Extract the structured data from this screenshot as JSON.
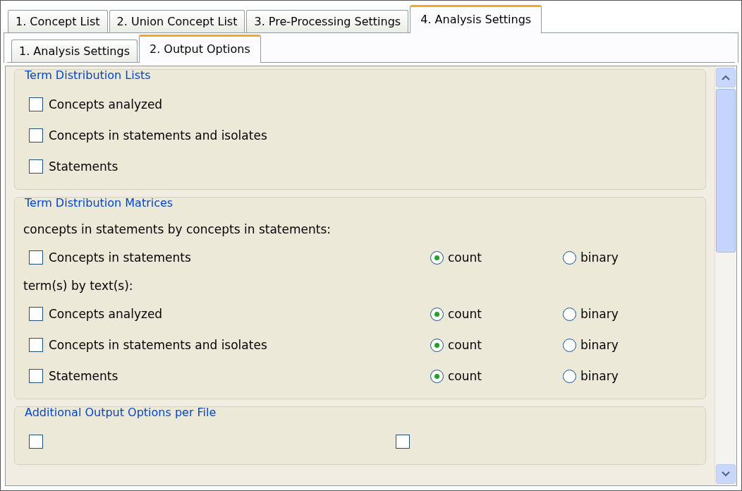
{
  "tabs": [
    {
      "label": "1. Concept List",
      "selected": false
    },
    {
      "label": "2. Union Concept List",
      "selected": false
    },
    {
      "label": "3. Pre-Processing Settings",
      "selected": false
    },
    {
      "label": "4. Analysis Settings",
      "selected": true
    }
  ],
  "subtabs": [
    {
      "label": "1. Analysis Settings",
      "selected": false
    },
    {
      "label": "2. Output Options",
      "selected": true
    }
  ],
  "sections": [
    {
      "title": "Term Distribution Lists",
      "items": [
        {
          "kind": "checkbox",
          "label": "Concepts analyzed",
          "checked": false
        },
        {
          "kind": "checkbox",
          "label": "Concepts in statements and isolates",
          "checked": false
        },
        {
          "kind": "checkbox",
          "label": "Statements",
          "checked": false
        }
      ]
    },
    {
      "title": "Term Distribution Matrices",
      "items": [
        {
          "kind": "label",
          "label": "concepts in statements by concepts in statements:"
        },
        {
          "kind": "option",
          "label": "Concepts in statements",
          "checked": false,
          "options": [
            {
              "label": "count",
              "selected": true
            },
            {
              "label": "binary",
              "selected": false
            }
          ]
        },
        {
          "kind": "label",
          "label": "term(s) by text(s):"
        },
        {
          "kind": "option",
          "label": "Concepts analyzed",
          "checked": false,
          "options": [
            {
              "label": "count",
              "selected": true
            },
            {
              "label": "binary",
              "selected": false
            }
          ]
        },
        {
          "kind": "option",
          "label": "Concepts in statements and isolates",
          "checked": false,
          "options": [
            {
              "label": "count",
              "selected": true
            },
            {
              "label": "binary",
              "selected": false
            }
          ]
        },
        {
          "kind": "option",
          "label": "Statements",
          "checked": false,
          "options": [
            {
              "label": "count",
              "selected": true
            },
            {
              "label": "binary",
              "selected": false
            }
          ]
        }
      ]
    },
    {
      "title": "Additional Output Options per File",
      "items": [
        {
          "kind": "pair",
          "checks": [
            {
              "checked": false
            },
            {
              "checked": false
            }
          ]
        }
      ]
    }
  ]
}
